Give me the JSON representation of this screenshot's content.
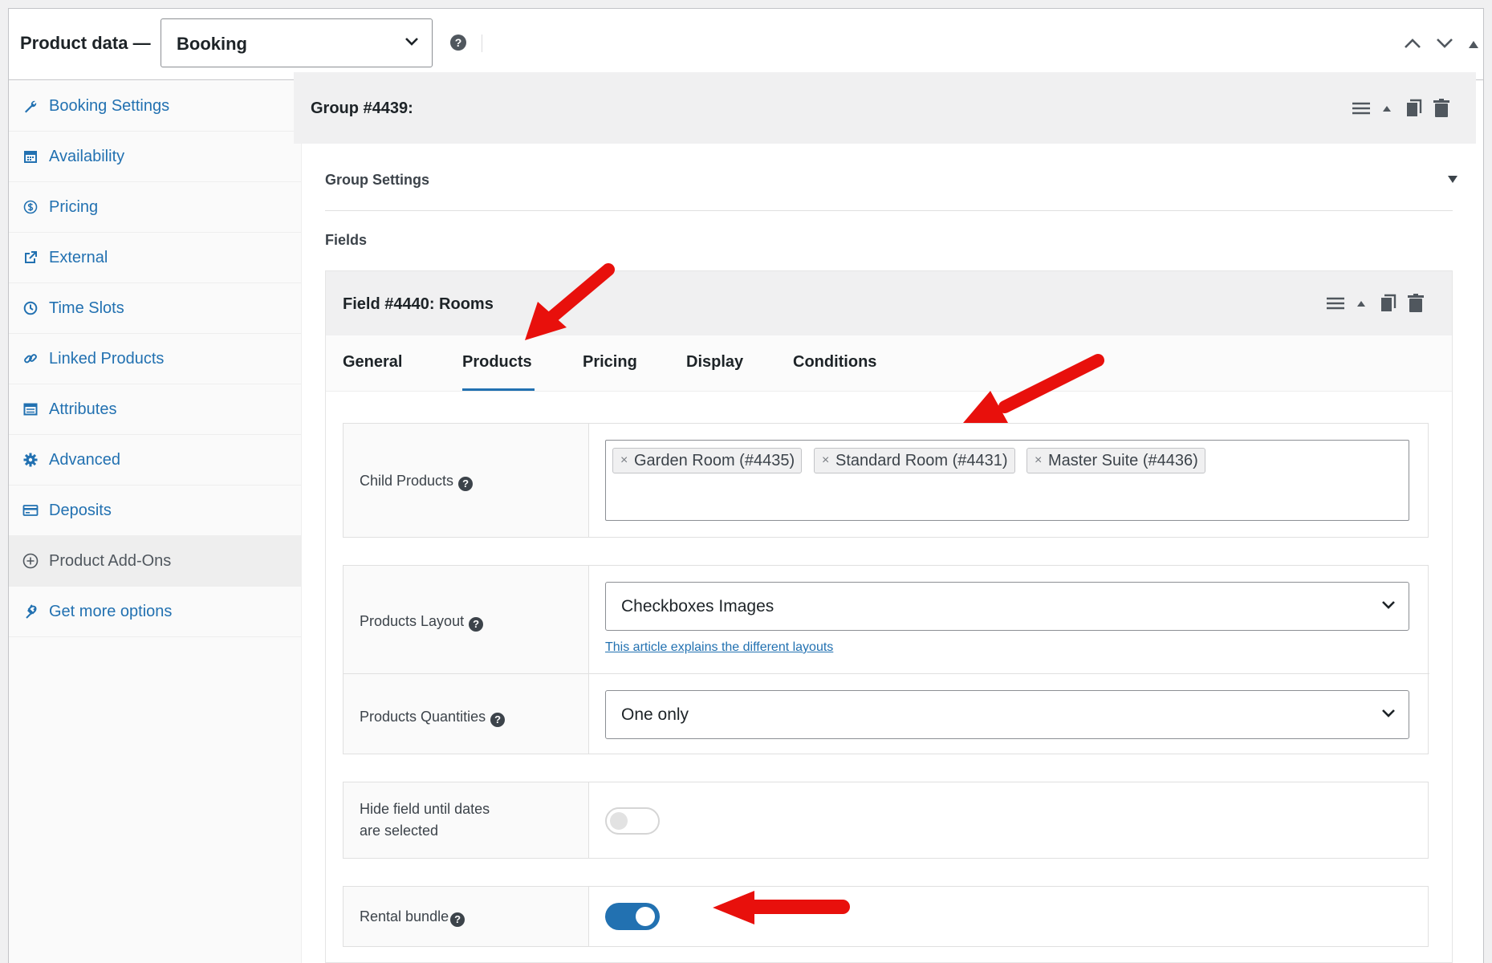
{
  "header": {
    "title": "Product data —",
    "product_type": "Booking"
  },
  "sidebar": {
    "items": [
      {
        "label": "Booking Settings",
        "icon": "wrench-icon"
      },
      {
        "label": "Availability",
        "icon": "calendar-icon"
      },
      {
        "label": "Pricing",
        "icon": "dollar-icon"
      },
      {
        "label": "External",
        "icon": "external-link-icon"
      },
      {
        "label": "Time Slots",
        "icon": "clock-icon"
      },
      {
        "label": "Linked Products",
        "icon": "link-icon"
      },
      {
        "label": "Attributes",
        "icon": "list-icon"
      },
      {
        "label": "Advanced",
        "icon": "gear-icon"
      },
      {
        "label": "Deposits",
        "icon": "card-icon"
      },
      {
        "label": "Product Add-Ons",
        "icon": "plus-circle-icon",
        "active": true
      },
      {
        "label": "Get more options",
        "icon": "plugin-icon"
      }
    ]
  },
  "group": {
    "title": "Group #4439:",
    "settings_label": "Group Settings",
    "fields_label": "Fields"
  },
  "field": {
    "title": "Field #4440: Rooms",
    "tabs": [
      "General",
      "Products",
      "Pricing",
      "Display",
      "Conditions"
    ],
    "active_tab": "Products"
  },
  "form": {
    "child_products": {
      "label": "Child Products",
      "tags": [
        "Garden Room (#4435)",
        "Standard Room (#4431)",
        "Master Suite (#4436)"
      ],
      "remove_glyph": "×"
    },
    "products_layout": {
      "label": "Products Layout",
      "value": "Checkboxes Images",
      "link_text": "This article explains the different layouts"
    },
    "products_quantities": {
      "label": "Products Quantities",
      "value": "One only"
    },
    "hide_field": {
      "label_line1": "Hide field until dates",
      "label_line2": "are selected",
      "enabled": false
    },
    "rental_bundle": {
      "label": "Rental bundle",
      "enabled": true
    }
  },
  "help_glyph": "?",
  "colors": {
    "accent": "#2271b1",
    "annotation_arrow": "#e8100c"
  }
}
